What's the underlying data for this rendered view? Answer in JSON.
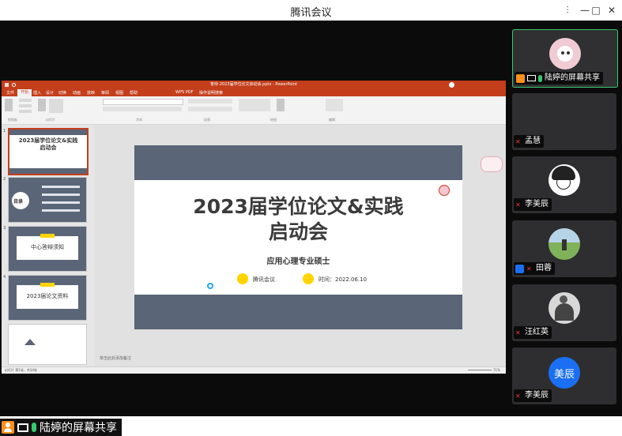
{
  "app": {
    "title": "腾讯会议"
  },
  "window_controls": {
    "pin": "⫶",
    "minimize": "—",
    "maximize": "□",
    "close": "✕"
  },
  "share": {
    "badge": "陆婷的屏幕共享"
  },
  "ppt": {
    "window_title": "答辩-2023届学位论文启动会.pptx - PowerPoint",
    "tabs": [
      "文件",
      "开始",
      "插入",
      "设计",
      "切换",
      "动画",
      "放映",
      "审阅",
      "视图",
      "帮助",
      "WPS PDF",
      "操作说明搜索"
    ],
    "groups": [
      "剪贴板",
      "幻灯片",
      "字体",
      "段落",
      "绘图",
      "编辑"
    ],
    "thumbs": [
      {
        "num": "1",
        "title": "2023届学位论文&实践\n启动会"
      },
      {
        "num": "2",
        "title": "目录"
      },
      {
        "num": "3",
        "title": "中心答辩须知"
      },
      {
        "num": "4",
        "title": "2023届论文资料"
      }
    ],
    "slide": {
      "title_line1": "2023届学位论文&实践",
      "title_line2": "启动会",
      "subtitle": "应用心理专业硕士",
      "info_left": "腾讯会议",
      "info_right": "时间：2022.06.10"
    },
    "notes_placeholder": "单击此处添加备注",
    "status_left": "幻灯片 第1张，共34张",
    "status_right": "71%"
  },
  "participants": [
    {
      "name": "陆婷的屏幕共享",
      "avatar_color": "#f1cbd4",
      "active": true
    },
    {
      "name": "孟慧",
      "avatar_color": null
    },
    {
      "name": "李美辰",
      "avatar_color": "#ffffff"
    },
    {
      "name": "田蓉",
      "avatar_color": "#7fb25a"
    },
    {
      "name": "汪红英",
      "avatar_color": "#d8d8d8"
    },
    {
      "name": "李美辰",
      "avatar_text": "美辰",
      "avatar_color": "#1a6ff2"
    }
  ],
  "colors": {
    "accent_green": "#37c96f",
    "ppt_red": "#c43e1c",
    "slide_bar": "#5a6577",
    "badge_yellow": "#ffd400",
    "avatar_blue": "#1a6ff2"
  }
}
